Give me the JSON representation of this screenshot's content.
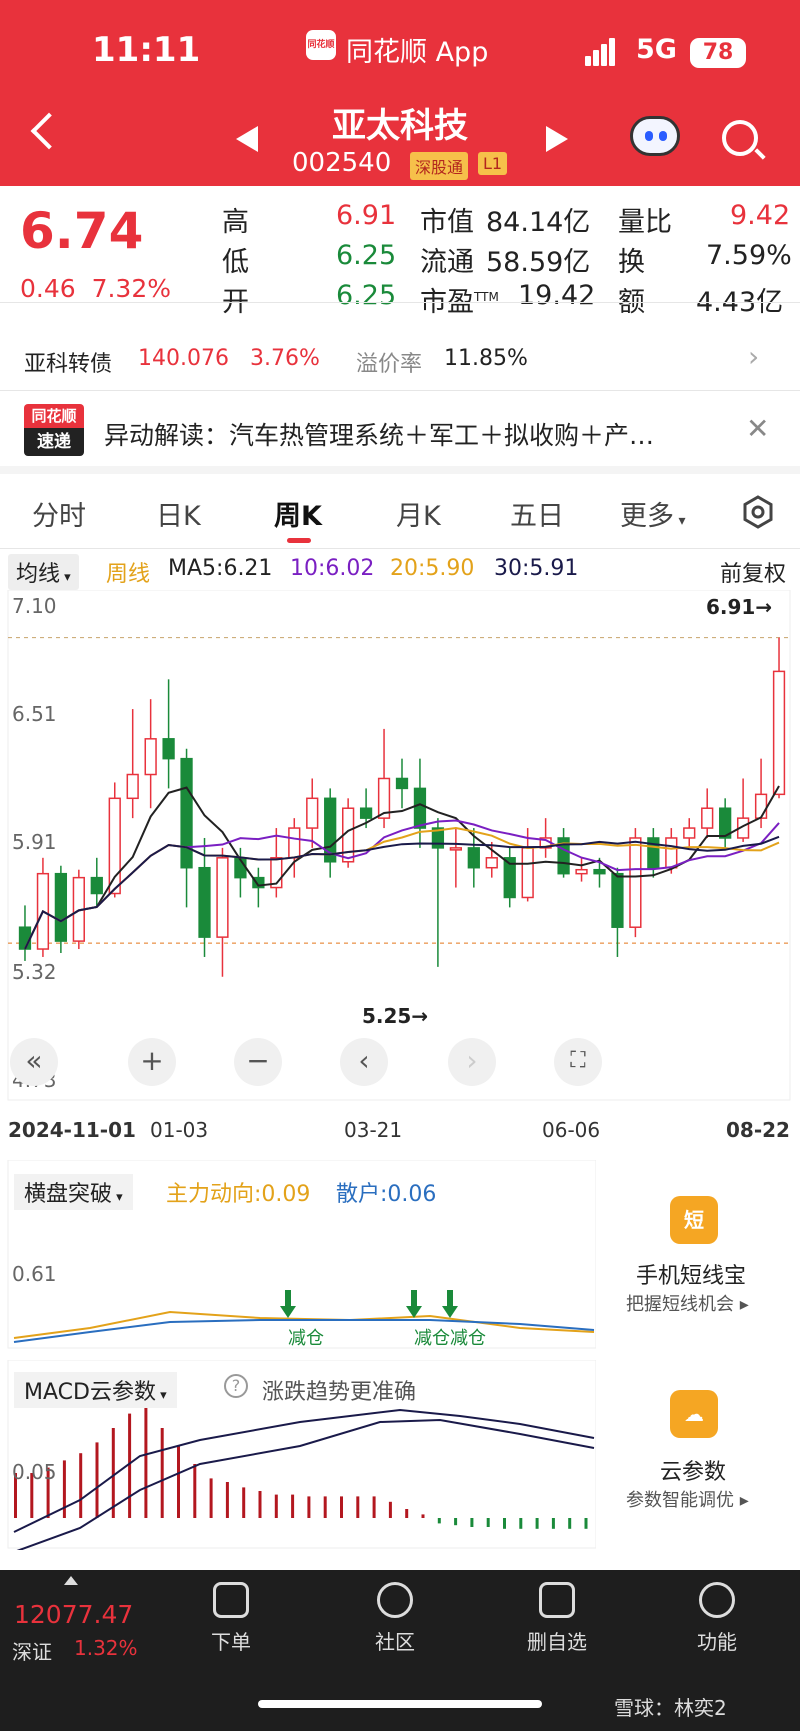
{
  "status": {
    "time": "11:11",
    "app_name": "同花顺 App",
    "app_logo": "同花顺",
    "network": "5G",
    "battery": "78"
  },
  "stock": {
    "name": "亚太科技",
    "code": "002540",
    "tags": [
      "深股通",
      "L1"
    ]
  },
  "quote": {
    "price": "6.74",
    "change": "0.46",
    "change_pct": "7.32%",
    "high_label": "高",
    "high": "6.91",
    "low_label": "低",
    "low": "6.25",
    "open_label": "开",
    "open": "6.25",
    "mcap_label": "市值",
    "mcap": "84.14亿",
    "float_label": "流通",
    "float": "58.59亿",
    "pe_label": "市盈",
    "pe_sup": "TTM",
    "pe": "19.42",
    "vr_label": "量比",
    "vr": "9.42",
    "turnover_label": "换",
    "turnover": "7.59%",
    "amount_label": "额",
    "amount": "4.43亿"
  },
  "bond": {
    "name": "亚科转债",
    "price": "140.076",
    "pct": "3.76%",
    "premium_label": "溢价率",
    "premium": "11.85%"
  },
  "news": {
    "logo_top": "同花顺",
    "logo_bottom": "速递",
    "text": "异动解读：汽车热管理系统＋军工＋拟收购＋产…"
  },
  "tabs": [
    "分时",
    "日K",
    "周K",
    "月K",
    "五日",
    "更多"
  ],
  "ma": {
    "selector": "均线",
    "period": "周线",
    "ma5": "MA5:6.21",
    "ma10": "10:6.02",
    "ma20": "20:5.90",
    "ma30": "30:5.91",
    "adjust": "前复权"
  },
  "colors": {
    "up": "#e8323c",
    "down": "#1a8a3a",
    "ma5": "#222222",
    "ma10": "#7a1fc2",
    "ma20": "#e3a21a",
    "ma30": "#1a1a4a"
  },
  "chart_data": {
    "type": "candlestick",
    "period": "weekly",
    "ylim": [
      4.73,
      7.1
    ],
    "y_ticks": [
      "7.10",
      "6.51",
      "5.91",
      "5.32",
      "4.73"
    ],
    "x_ticks": [
      "2024-11-01",
      "01-03",
      "03-21",
      "06-06",
      "08-22"
    ],
    "max_label": "6.91→",
    "min_label": "5.25→",
    "candles": [
      [
        5.45,
        5.34,
        5.56,
        5.28
      ],
      [
        5.34,
        5.72,
        5.8,
        5.3
      ],
      [
        5.72,
        5.38,
        5.76,
        5.32
      ],
      [
        5.38,
        5.7,
        5.74,
        5.34
      ],
      [
        5.7,
        5.62,
        5.8,
        5.55
      ],
      [
        5.62,
        6.1,
        6.18,
        5.6
      ],
      [
        6.1,
        6.22,
        6.55,
        6.0
      ],
      [
        6.22,
        6.4,
        6.6,
        6.05
      ],
      [
        6.4,
        6.3,
        6.7,
        6.15
      ],
      [
        6.3,
        5.75,
        6.35,
        5.55
      ],
      [
        5.75,
        5.4,
        5.9,
        5.3
      ],
      [
        5.4,
        5.8,
        5.85,
        5.2
      ],
      [
        5.8,
        5.7,
        5.85,
        5.6
      ],
      [
        5.7,
        5.65,
        5.75,
        5.55
      ],
      [
        5.65,
        5.8,
        5.95,
        5.6
      ],
      [
        5.8,
        5.95,
        6.0,
        5.7
      ],
      [
        5.95,
        6.1,
        6.2,
        5.85
      ],
      [
        6.1,
        5.78,
        6.15,
        5.7
      ],
      [
        5.78,
        6.05,
        6.1,
        5.75
      ],
      [
        6.05,
        6.0,
        6.15,
        5.95
      ],
      [
        6.0,
        6.2,
        6.45,
        5.95
      ],
      [
        6.2,
        6.15,
        6.3,
        6.05
      ],
      [
        6.15,
        5.95,
        6.3,
        5.85
      ],
      [
        5.95,
        5.85,
        6.0,
        5.25
      ],
      [
        5.85,
        5.85,
        5.95,
        5.65
      ],
      [
        5.85,
        5.75,
        5.95,
        5.65
      ],
      [
        5.75,
        5.8,
        5.88,
        5.7
      ],
      [
        5.8,
        5.6,
        5.85,
        5.55
      ],
      [
        5.6,
        5.85,
        5.95,
        5.58
      ],
      [
        5.85,
        5.9,
        6.0,
        5.8
      ],
      [
        5.9,
        5.72,
        5.95,
        5.7
      ],
      [
        5.72,
        5.74,
        5.8,
        5.68
      ],
      [
        5.74,
        5.72,
        5.8,
        5.65
      ],
      [
        5.72,
        5.45,
        5.75,
        5.3
      ],
      [
        5.45,
        5.9,
        5.95,
        5.4
      ],
      [
        5.9,
        5.75,
        5.95,
        5.7
      ],
      [
        5.75,
        5.9,
        5.95,
        5.72
      ],
      [
        5.9,
        5.95,
        6.0,
        5.85
      ],
      [
        5.95,
        6.05,
        6.15,
        5.9
      ],
      [
        6.05,
        5.9,
        6.1,
        5.85
      ],
      [
        5.9,
        6.0,
        6.2,
        5.88
      ],
      [
        6.0,
        6.12,
        6.3,
        5.95
      ],
      [
        6.12,
        6.74,
        6.91,
        6.1
      ]
    ]
  },
  "zoom_controls": [
    "«",
    "+",
    "−",
    "‹",
    "›",
    "⛶"
  ],
  "indicator1": {
    "selector": "横盘突破",
    "main": "主力动向:0.09",
    "retail": "散户:0.06",
    "tick": "0.61",
    "signals": [
      "减仓",
      "减仓",
      "减仓"
    ],
    "side_title": "手机短线宝",
    "side_sub": "把握短线机会",
    "side_icon": "短"
  },
  "indicator2": {
    "selector": "MACD云参数",
    "hint": "涨跌趋势更准确",
    "tick": "0.05",
    "side_title": "云参数",
    "side_sub": "参数智能调优",
    "side_icon": "☁"
  },
  "bottom": {
    "index_value": "12077.47",
    "index_name": "深证",
    "index_pct": "1.32%",
    "nav": [
      "下单",
      "社区",
      "删自选",
      "功能"
    ]
  },
  "watermark": "雪球：林奕2"
}
